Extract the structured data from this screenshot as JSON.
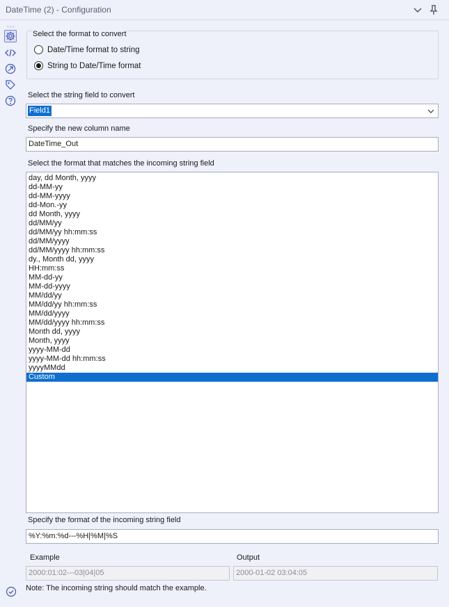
{
  "window": {
    "title": "DateTime (2) - Configuration"
  },
  "rail": {
    "dots": "...",
    "icons": [
      "gear-icon",
      "code-icon",
      "connection-icon",
      "tag-icon",
      "help-icon"
    ]
  },
  "format_group": {
    "legend": "Select the format to convert",
    "options": [
      {
        "label": "Date/Time format to string",
        "checked": false
      },
      {
        "label": "String to Date/Time format",
        "checked": true
      }
    ]
  },
  "string_field": {
    "label": "Select the string field to convert",
    "selected": "Field1"
  },
  "new_column": {
    "label": "Specify the new column name",
    "value": "DateTime_Out"
  },
  "format_list": {
    "label": "Select the format that matches the incoming string field",
    "items": [
      "day, dd Month, yyyy",
      "dd-MM-yy",
      "dd-MM-yyyy",
      "dd-Mon.-yy",
      "dd Month, yyyy",
      "dd/MM/yy",
      "dd/MM/yy hh:mm:ss",
      "dd/MM/yyyy",
      "dd/MM/yyyy hh:mm:ss",
      "dy., Month dd, yyyy",
      "HH:mm:ss",
      "MM-dd-yy",
      "MM-dd-yyyy",
      "MM/dd/yy",
      "MM/dd/yy hh:mm:ss",
      "MM/dd/yyyy",
      "MM/dd/yyyy hh:mm:ss",
      "Month dd, yyyy",
      "Month, yyyy",
      "yyyy-MM-dd",
      "yyyy-MM-dd hh:mm:ss",
      "yyyyMMdd",
      "Custom"
    ],
    "selected_index": 22
  },
  "custom_format": {
    "label": "Specify the format of the incoming string field",
    "value": "%Y:%m:%d---%H|%M|%S"
  },
  "example": {
    "example_label": "Example",
    "output_label": "Output",
    "example_value": "2000:01:02---03|04|05",
    "output_value": "2000-01-02 03:04:05"
  },
  "note": "Note: The incoming string should match the example.",
  "colors": {
    "background": "#eef0fa",
    "accent": "#0f6fce",
    "border": "#a9adbd"
  }
}
